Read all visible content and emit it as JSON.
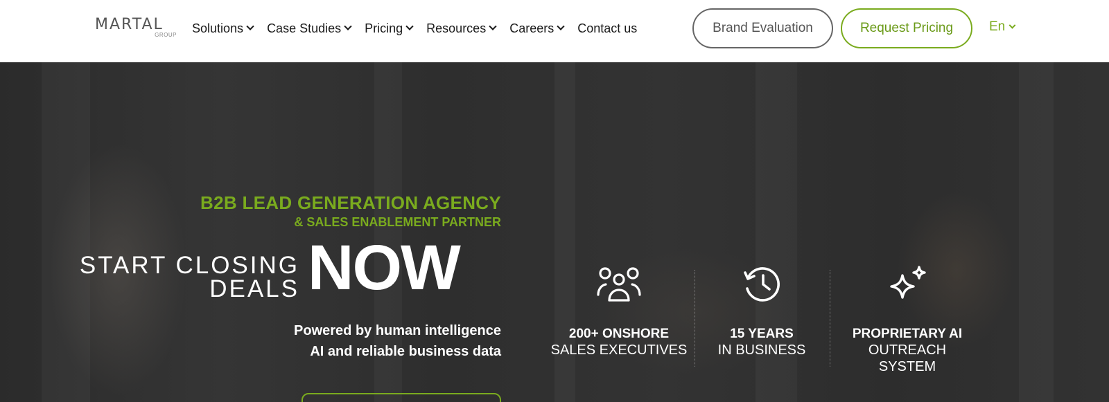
{
  "logo": {
    "main": "MARTAL",
    "sub": "GROUP"
  },
  "nav": [
    {
      "label": "Solutions",
      "dropdown": true
    },
    {
      "label": "Case Studies",
      "dropdown": true
    },
    {
      "label": "Pricing",
      "dropdown": true
    },
    {
      "label": "Resources",
      "dropdown": true
    },
    {
      "label": "Careers",
      "dropdown": true
    },
    {
      "label": "Contact us",
      "dropdown": false
    }
  ],
  "buttons": {
    "brand": "Brand Evaluation",
    "pricing": "Request Pricing"
  },
  "language": "En",
  "colors": {
    "accent": "#7aab1e",
    "header_bg": "#ffffff",
    "hero_bg": "#2e2e2e"
  },
  "hero": {
    "tagline1": "B2B LEAD GENERATION AGENCY",
    "tagline2": "& SALES ENABLEMENT PARTNER",
    "start_line1": "START CLOSING",
    "start_line2": "DEALS",
    "now": "NOW",
    "powered_line1": "Powered by human intelligence",
    "powered_line2": "AI and reliable business data"
  },
  "stats": [
    {
      "icon": "people-group-icon",
      "bold": "200+ ONSHORE",
      "sub": "SALES EXECUTIVES"
    },
    {
      "icon": "clock-history-icon",
      "bold": "15 YEARS",
      "sub": "IN BUSINESS"
    },
    {
      "icon": "sparkles-icon",
      "bold": "PROPRIETARY AI",
      "sub": "OUTREACH SYSTEM"
    }
  ]
}
